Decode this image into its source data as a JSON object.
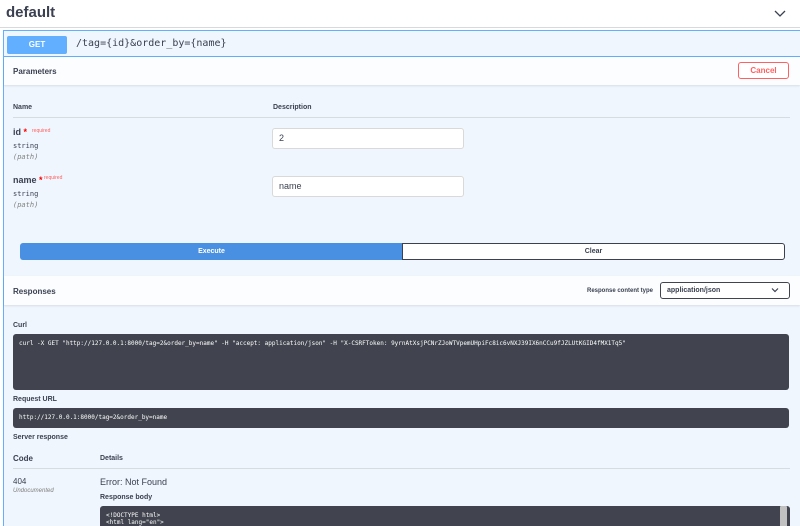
{
  "tag": {
    "title": "default"
  },
  "operation": {
    "method": "GET",
    "path": "/tag={id}&order_by={name}"
  },
  "parameters_section": {
    "title": "Parameters",
    "cancel_label": "Cancel",
    "col_name": "Name",
    "col_description": "Description",
    "required_star": "*",
    "params": [
      {
        "name": "id",
        "required_label": "required",
        "type": "string",
        "in": "(path)",
        "value": "2"
      },
      {
        "name": "name",
        "required_label": "required",
        "type": "string",
        "in": "(path)",
        "value": "name"
      }
    ]
  },
  "actions": {
    "execute_label": "Execute",
    "clear_label": "Clear"
  },
  "responses_section": {
    "title": "Responses",
    "content_type_label": "Response content type",
    "content_type_value": "application/json"
  },
  "results": {
    "curl_label": "Curl",
    "curl_command": "curl -X GET \"http://127.0.0.1:8000/tag=2&order_by=name\" -H \"accept: application/json\" -H \"X-CSRFToken: 9yrnAtXsjPCNrZJoWTVpemUHpiFc8ic6vNXJ39IX6nCCu9fJZLUtKGID4fMX1Tq5\"",
    "request_url_label": "Request URL",
    "request_url": "http://127.0.0.1:8000/tag=2&order_by=name",
    "server_response_label": "Server response",
    "col_code": "Code",
    "col_details": "Details",
    "response_code": "404",
    "response_undocumented": "Undocumented",
    "response_title": "Error: Not Found",
    "response_body_label": "Response body",
    "response_body": "<!DOCTYPE html>\n<html lang=\"en\">"
  },
  "colors": {
    "get_blue": "#61affe",
    "execute_blue": "#4990e2",
    "cancel_red": "#ff6060",
    "code_bg": "#41444e"
  },
  "icons": {
    "collapse": "chevron-down-icon",
    "select": "chevron-down-icon"
  }
}
